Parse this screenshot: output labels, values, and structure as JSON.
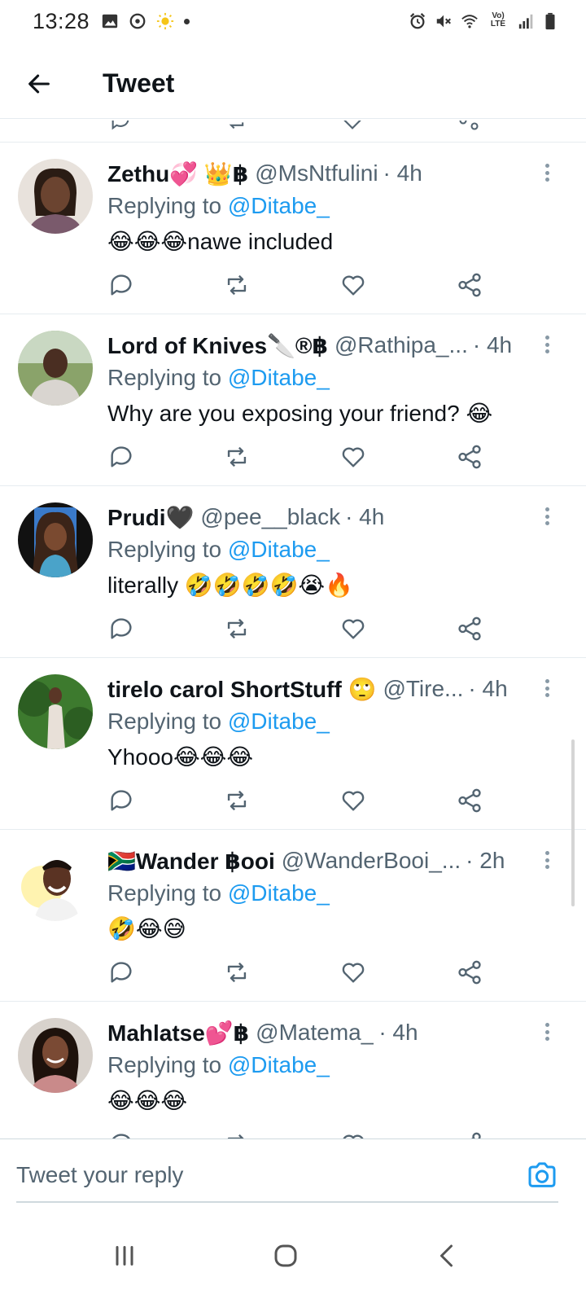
{
  "status_bar": {
    "time": "13:28",
    "left_icons": [
      "gallery-icon",
      "sync-icon",
      "sun-icon",
      "dot-icon"
    ],
    "right_icons": [
      "alarm-icon",
      "mute-icon",
      "wifi-icon",
      "volte-icon",
      "signal-icon",
      "battery-icon"
    ],
    "volte_label": "Vo) LTE"
  },
  "header": {
    "title": "Tweet"
  },
  "tweets": [
    {
      "name": "Zethu💞 👑฿",
      "handle": "@MsNtfulini",
      "time": "· 4h",
      "replying_prefix": "Replying to ",
      "replying_to": "@Ditabe_",
      "text": "😂😂😂nawe included"
    },
    {
      "name": "Lord of Knives🔪®฿",
      "handle": "@Rathipa_...",
      "time": "· 4h",
      "replying_prefix": "Replying to ",
      "replying_to": "@Ditabe_",
      "text": "Why are you exposing your friend? 😂"
    },
    {
      "name": "Prudi🖤",
      "handle": "@pee__black",
      "time": "· 4h",
      "replying_prefix": "Replying to ",
      "replying_to": "@Ditabe_",
      "text": "literally 🤣🤣🤣🤣😭🔥"
    },
    {
      "name": "tirelo carol ShortStuff 🙄",
      "handle": "@Tire...",
      "time": "· 4h",
      "replying_prefix": "Replying to ",
      "replying_to": "@Ditabe_",
      "text": "Yhooo😂😂😂"
    },
    {
      "name": "🇿🇦Wander ฿ooi",
      "handle": "@WanderBooi_...",
      "time": "· 2h",
      "replying_prefix": "Replying to ",
      "replying_to": "@Ditabe_",
      "text": "🤣😂😅"
    },
    {
      "name": "Mahlatse💕฿",
      "handle": "@Matema_",
      "time": "· 4h",
      "replying_prefix": "Replying to ",
      "replying_to": "@Ditabe_",
      "text": "😂😂😂"
    }
  ],
  "reply_bar": {
    "placeholder": "Tweet your reply"
  },
  "colors": {
    "accent": "#1d9bf0",
    "text_primary": "#0f1419",
    "text_secondary": "#536471",
    "divider": "#e6ecf0"
  }
}
